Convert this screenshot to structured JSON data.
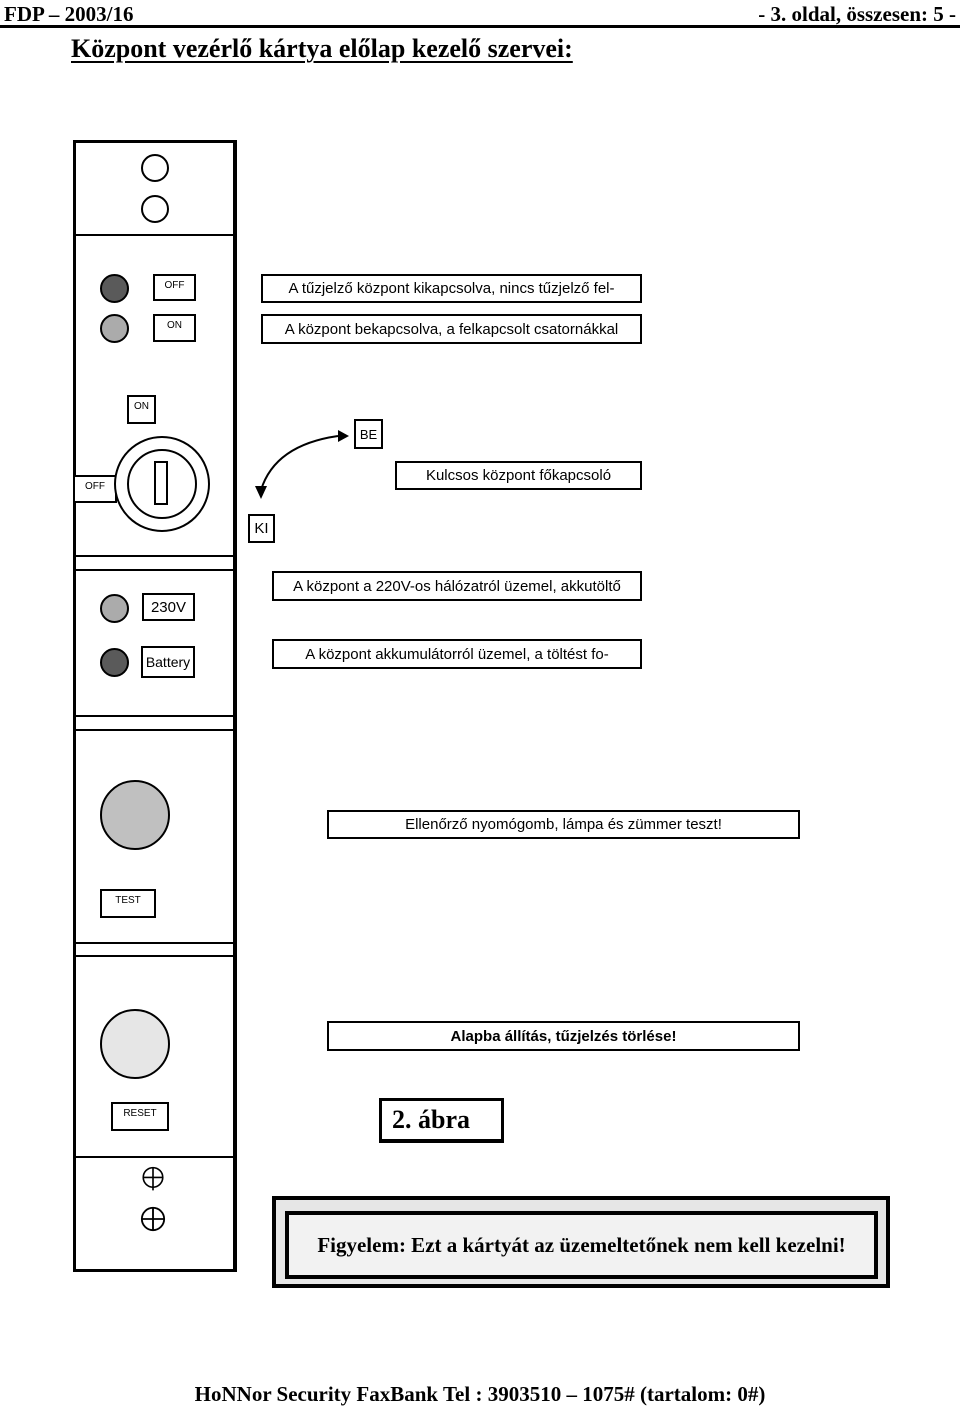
{
  "header": {
    "doc_id": "FDP – 2003/16",
    "page_info": "- 3. oldal, összesen: 5 -"
  },
  "title": "Központ vezérlő kártya előlap kezelő szervei:",
  "panel": {
    "power_status": {
      "off_label": "OFF",
      "on_label": "ON",
      "off_led_color": "#5a5a5a",
      "on_led_color": "#ababab"
    },
    "key_switch": {
      "on_label": "ON",
      "off_label": "OFF",
      "be_label": "BE",
      "ki_label": "KI"
    },
    "supply": {
      "mains_label": "230V",
      "battery_label": "Battery",
      "mains_led_color": "#ababab",
      "battery_led_color": "#5a5a5a"
    },
    "test": {
      "label": "TEST",
      "button_color": "#c0c0c0"
    },
    "reset": {
      "label": "RESET",
      "button_color": "#e6e6e6"
    }
  },
  "descriptions": {
    "off_state": "A tűzjelző központ kikapcsolva, nincs tűzjelző fel-",
    "on_state": "A központ bekapcsolva, a felkapcsolt csatornákkal",
    "key_switch": "Kulcsos központ főkapcsoló",
    "mains": "A központ a 220V-os hálózatról üzemel, akkutöltő",
    "battery": "A központ akkumulátorról üzemel, a töltést fo-",
    "test": "Ellenőrző nyomógomb, lámpa és zümmer teszt!",
    "reset": "Alapba állítás, tűzjelzés törlése!"
  },
  "figure_label": "2. ábra",
  "warning": "Figyelem: Ezt a kártyát az üzemeltetőnek nem kell kezelni!",
  "footer": "HoNNor Security FaxBank Tel :  3903510 – 1075# (tartalom: 0#)"
}
